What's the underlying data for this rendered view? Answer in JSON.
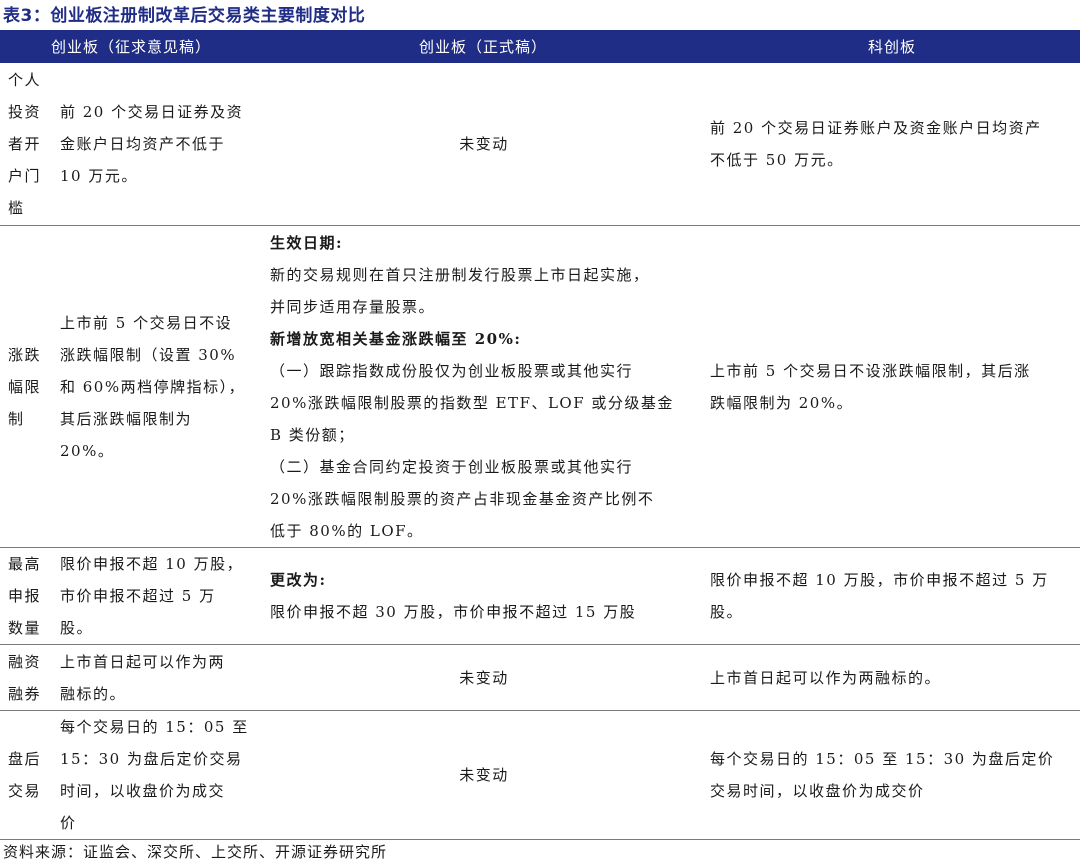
{
  "title": "表3：创业板注册制改革后交易类主要制度对比",
  "header": {
    "col1": "创业板（征求意见稿）",
    "col2": "创业板（正式稿）",
    "col3": "科创板"
  },
  "rows": [
    {
      "label": [
        "个人",
        "投资",
        "者开",
        "户门",
        "槛"
      ],
      "col1": [
        "前 20 个交易日证券及资",
        "金账户日均资产不低于",
        "10 万元。"
      ],
      "col2": [
        "未变动"
      ],
      "col3": [
        "前 20 个交易日证券账户及资金账户日均资产",
        "不低于 50 万元。"
      ]
    },
    {
      "label": [
        "涨跌",
        "幅限",
        "制"
      ],
      "col1": [
        "上市前 5 个交易日不设",
        "涨跌幅限制（设置 30%",
        "和 60%两档停牌指标），",
        "其后涨跌幅限制为",
        "20%。"
      ],
      "col2": [
        "生效日期:",
        "新的交易规则在首只注册制发行股票上市日起实施，",
        "并同步适用存量股票。",
        "新增放宽相关基金涨跌幅至 20%:",
        "（一）跟踪指数成份股仅为创业板股票或其他实行",
        "20%涨跌幅限制股票的指数型 ETF、LOF 或分级基金",
        "B 类份额；",
        "（二）基金合同约定投资于创业板股票或其他实行",
        "20%涨跌幅限制股票的资产占非现金基金资产比例不",
        "低于 80%的 LOF。"
      ],
      "col3": [
        "上市前 5 个交易日不设涨跌幅限制，其后涨",
        "跌幅限制为 20%。"
      ]
    },
    {
      "label": [
        "最高",
        "申报",
        "数量"
      ],
      "col1": [
        "限价申报不超 10 万股，",
        "市价申报不超过 5 万",
        "股。"
      ],
      "col2": [
        "更改为:",
        "限价申报不超 30 万股，市价申报不超过 15 万股"
      ],
      "col3": [
        "限价申报不超 10 万股，市价申报不超过 5 万",
        "股。"
      ]
    },
    {
      "label": [
        "融资",
        "融券"
      ],
      "col1": [
        "上市首日起可以作为两",
        "融标的。"
      ],
      "col2": [
        "未变动"
      ],
      "col3": [
        "上市首日起可以作为两融标的。"
      ]
    },
    {
      "label": [
        "盘后",
        "交易"
      ],
      "col1": [
        "每个交易日的 15：05 至",
        "15：30 为盘后定价交易",
        "时间，以收盘价为成交",
        "价"
      ],
      "col2": [
        "未变动"
      ],
      "col3": [
        "每个交易日的 15：05 至 15：30 为盘后定价",
        "交易时间，以收盘价为成交价"
      ]
    }
  ],
  "source": "资料来源：证监会、深交所、上交所、开源证券研究所",
  "colors": {
    "header_bg": "#1f2d86",
    "title": "#1f2d86",
    "rule": "#7a7a7a"
  }
}
